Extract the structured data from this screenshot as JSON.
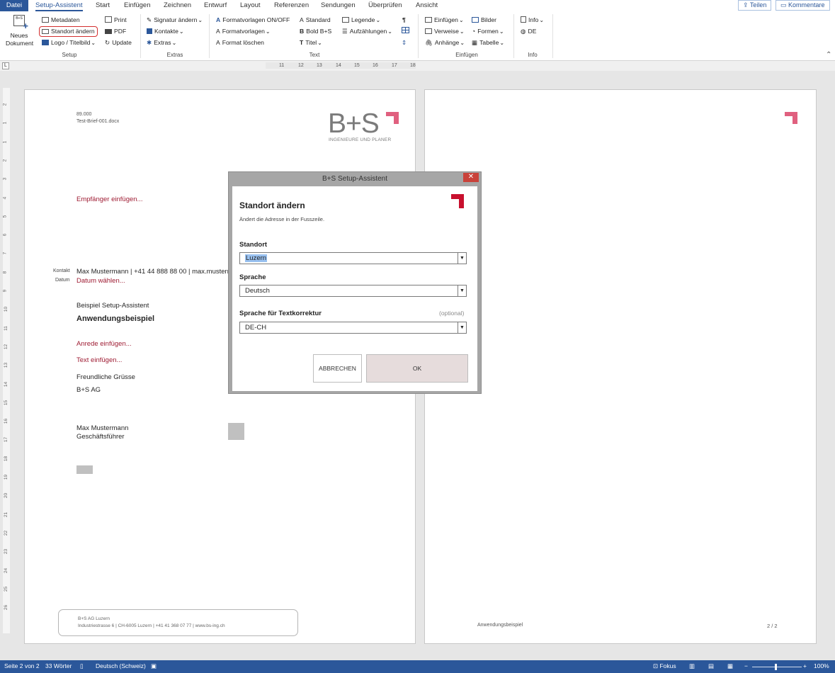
{
  "tabs": {
    "file": "Datei",
    "items": [
      "Setup-Assistent",
      "Start",
      "Einfügen",
      "Zeichnen",
      "Entwurf",
      "Layout",
      "Referenzen",
      "Sendungen",
      "Überprüfen",
      "Ansicht"
    ],
    "share": "Teilen",
    "comments": "Kommentare"
  },
  "ribbon": {
    "new_doc_line1": "Neues",
    "new_doc_line2": "Dokument",
    "new_doc_icon_text": "B+S",
    "setup": {
      "metadaten": "Metadaten",
      "standort": "Standort ändern",
      "logo": "Logo / Titelbild",
      "print": "Print",
      "pdf": "PDF",
      "update": "Update",
      "group": "Setup"
    },
    "extras": {
      "signatur": "Signatur ändern",
      "kontakte": "Kontakte",
      "extras": "Extras",
      "group": "Extras"
    },
    "text": {
      "fv_onoff": "Formatvorlagen ON/OFF",
      "fv": "Formatvorlagen",
      "format_loeschen": "Format löschen",
      "standard": "Standard",
      "bold": "Bold B+S",
      "titel": "Titel",
      "legende": "Legende",
      "aufz": "Aufzählungen",
      "group": "Text"
    },
    "einfuegen": {
      "einfuegen": "Einfügen",
      "verweise": "Verweise",
      "anhaenge": "Anhänge",
      "bilder": "Bilder",
      "formen": "Formen",
      "tabelle": "Tabelle",
      "group": "Einfügen"
    },
    "info": {
      "info": "Info",
      "de": "DE",
      "group": "Info"
    }
  },
  "ruler": {
    "numbers": [
      "11",
      "12",
      "13",
      "14",
      "15",
      "16",
      "17",
      "18"
    ]
  },
  "vruler": [
    "2",
    "1",
    "1",
    "2",
    "3",
    "4",
    "5",
    "6",
    "7",
    "8",
    "9",
    "10",
    "11",
    "12",
    "13",
    "14",
    "15",
    "16",
    "17",
    "18",
    "19",
    "20",
    "21",
    "22",
    "23",
    "24",
    "25",
    "26"
  ],
  "page1": {
    "ref1": "89.000",
    "ref2": "Test-Brief-001.docx",
    "logo_text": "B+S",
    "logo_sub": "INGENIEURE UND PLANER",
    "recipient": "Empfänger einfügen...",
    "kontakt_label": "Kontakt",
    "kontakt_value": "Max Mustermann | +41 44 888 88 00 | max.musterm",
    "datum_label": "Datum",
    "datum_value": "Datum wählen...",
    "subject_small": "Beispiel Setup-Assistent",
    "subject": "Anwendungsbeispiel",
    "anrede": "Anrede einfügen...",
    "text": "Text einfügen...",
    "gruss": "Freundliche Grüsse",
    "company": "B+S AG",
    "sig_name": "Max Mustermann",
    "sig_title": "Geschäftsführer",
    "footer1": "B+S AG Luzern",
    "footer2": "Industriestrasse 6 | CH-6005 Luzern | +41 41 368 07 77 | www.bs-ing.ch"
  },
  "page2": {
    "footer_left": "Anwendungsbeispiel",
    "footer_right": "2 / 2"
  },
  "dialog": {
    "title": "B+S Setup-Assistent",
    "close": "✕",
    "heading": "Standort ändern",
    "desc": "Ändert die Adresse in der Fusszeile.",
    "standort_label": "Standort",
    "standort_value": "Luzern",
    "sprache_label": "Sprache",
    "sprache_value": "Deutsch",
    "korrektur_label": "Sprache für Textkorrektur",
    "korrektur_optional": "(optional)",
    "korrektur_value": "DE-CH",
    "cancel": "ABBRECHEN",
    "ok": "OK"
  },
  "status": {
    "page": "Seite 2 von 2",
    "words": "33 Wörter",
    "lang": "Deutsch (Schweiz)",
    "focus": "Fokus",
    "zoom": "100%"
  },
  "colors": {
    "accent": "#2b579a",
    "brand_red": "#c8102e",
    "placeholder_red": "#9e1b32"
  }
}
